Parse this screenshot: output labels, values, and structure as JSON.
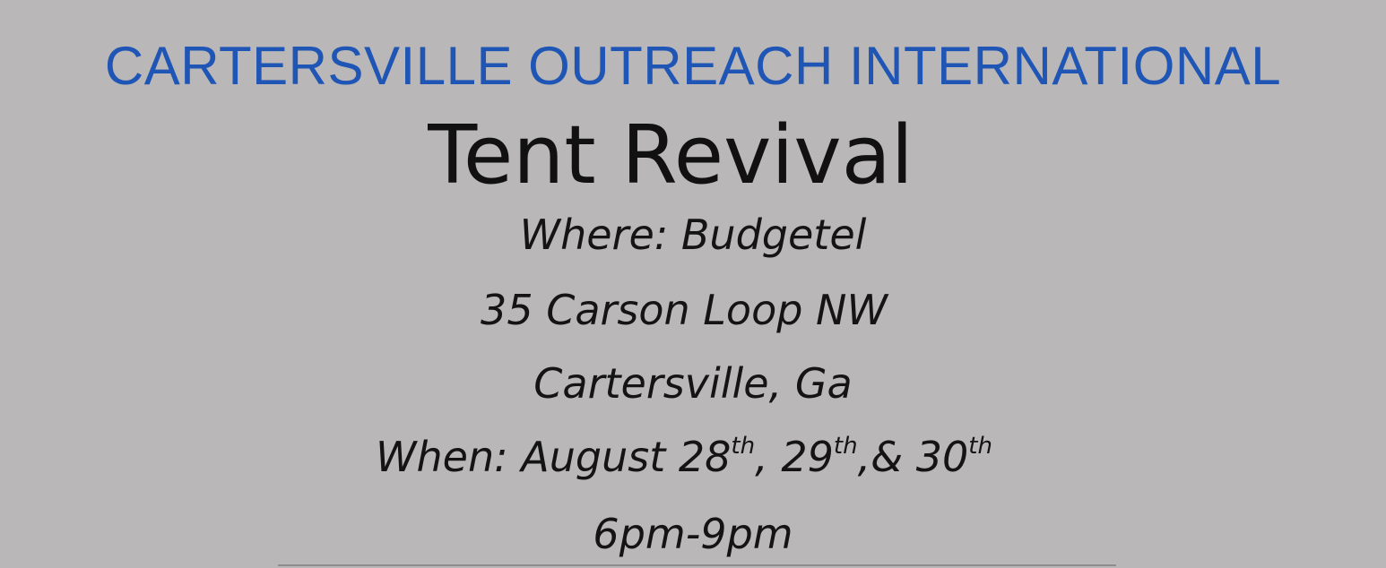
{
  "flyer": {
    "organization": "CARTERSVILLE OUTREACH INTERNATIONAL",
    "title": "Tent Revival",
    "where_label": "Where:",
    "where_value": "Budgetel",
    "address_line": "35 Carson Loop NW",
    "city_line": "Cartersville, Ga",
    "when_label": "When:",
    "when_month": "August",
    "dates": [
      {
        "day": "28",
        "suffix": "th",
        "sep": ","
      },
      {
        "day": "29",
        "suffix": "th",
        "sep": ",&"
      },
      {
        "day": "30",
        "suffix": "th",
        "sep": ""
      }
    ],
    "time": "6pm-9pm"
  },
  "colors": {
    "background": "#b9b7b8",
    "organization_text": "#1f55b5",
    "body_text": "#111111"
  }
}
